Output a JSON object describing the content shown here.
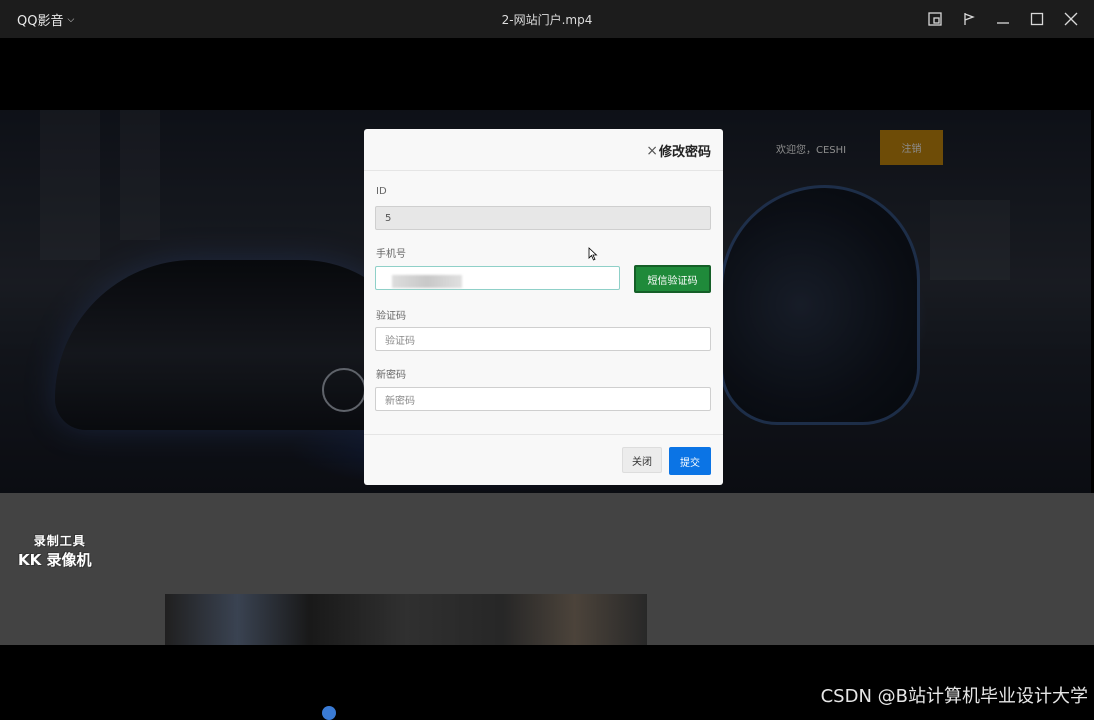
{
  "player": {
    "app_name": "QQ影音",
    "video_title": "2-网站门户.mp4",
    "icons": [
      "snapshot-icon",
      "pin-icon",
      "minimize-icon",
      "maximize-icon",
      "close-icon"
    ]
  },
  "site": {
    "welcome_text": "欢迎您，CESHI",
    "register_label": "注销"
  },
  "modal": {
    "title": "修改密码",
    "close_symbol": "×",
    "id_label": "ID",
    "id_value": "5",
    "phone_label": "手机号",
    "sms_button": "短信验证码",
    "code_label": "验证码",
    "code_placeholder": "验证码",
    "newpwd_label": "新密码",
    "newpwd_placeholder": "新密码",
    "close_button": "关闭",
    "submit_button": "提交"
  },
  "watermark": {
    "line1": "录制工具",
    "line2": "KK 录像机"
  },
  "footer_credit": "CSDN @B站计算机毕业设计大学"
}
